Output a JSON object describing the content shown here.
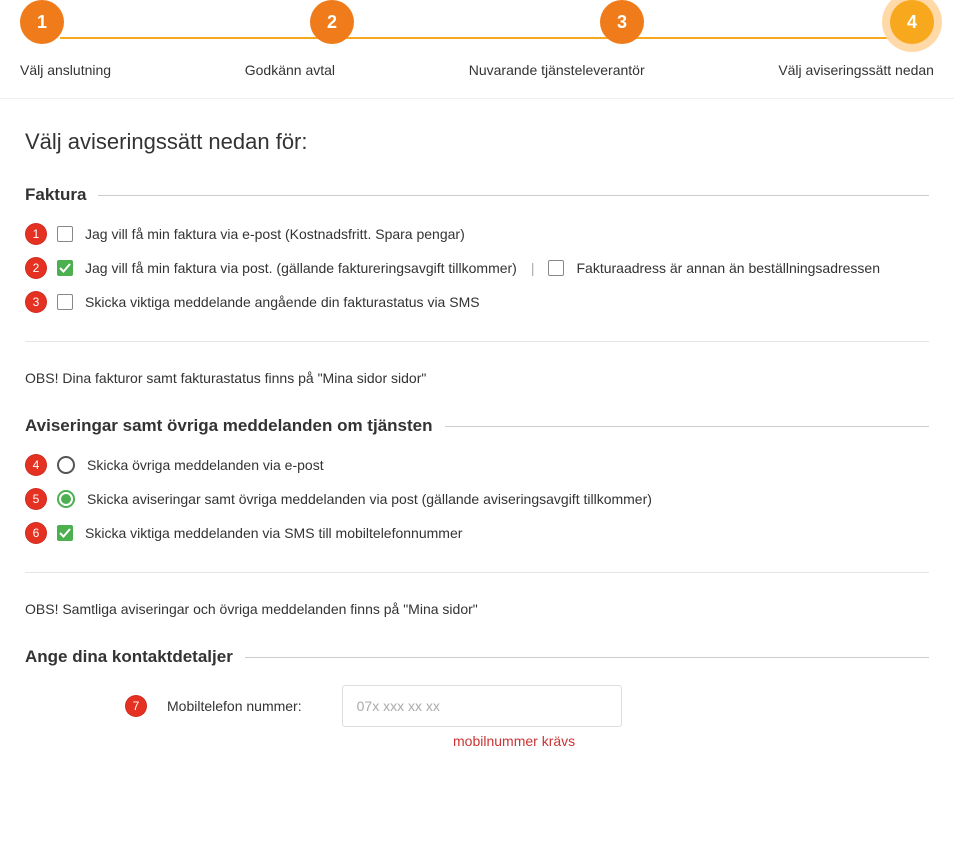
{
  "stepper": {
    "steps": [
      {
        "num": "1",
        "label": "Välj anslutning"
      },
      {
        "num": "2",
        "label": "Godkänn avtal"
      },
      {
        "num": "3",
        "label": "Nuvarande tjänsteleverantör"
      },
      {
        "num": "4",
        "label": "Välj aviseringssätt nedan"
      }
    ],
    "current_index": 3
  },
  "page_title": "Välj aviseringssätt nedan för:",
  "sections": {
    "faktura": {
      "heading": "Faktura",
      "options": {
        "email_invoice": "Jag vill få min faktura via e-post (Kostnadsfritt. Spara pengar)",
        "post_invoice": "Jag vill få min faktura via post. (gällande faktureringsavgift tillkommer)",
        "diff_address": "Fakturaadress är annan än beställningsadressen",
        "sms_invoice": "Skicka viktiga meddelande angående din fakturastatus via SMS"
      },
      "note": "OBS! Dina fakturor samt fakturastatus finns på \"Mina sidor sidor\""
    },
    "avisering": {
      "heading": "Aviseringar samt övriga meddelanden om tjänsten",
      "options": {
        "email_other": "Skicka övriga meddelanden via e-post",
        "post_other": "Skicka aviseringar samt övriga meddelanden via post (gällande aviseringsavgift tillkommer)",
        "sms_other": "Skicka viktiga meddelanden via SMS till mobiltelefonnummer"
      },
      "note": "OBS! Samtliga aviseringar och övriga meddelanden finns på \"Mina sidor\""
    },
    "contact": {
      "heading": "Ange dina kontaktdetaljer",
      "mobile_label": "Mobiltelefon nummer:",
      "mobile_placeholder": "07x xxx xx xx",
      "mobile_error": "mobilnummer krävs"
    }
  },
  "markers": {
    "m1": "1",
    "m2": "2",
    "m3": "3",
    "m4": "4",
    "m5": "5",
    "m6": "6",
    "m7": "7"
  },
  "colors": {
    "step_active": "#f07b1a",
    "step_current": "#f7a81d",
    "marker": "#e53122",
    "check_green": "#4caf50"
  }
}
